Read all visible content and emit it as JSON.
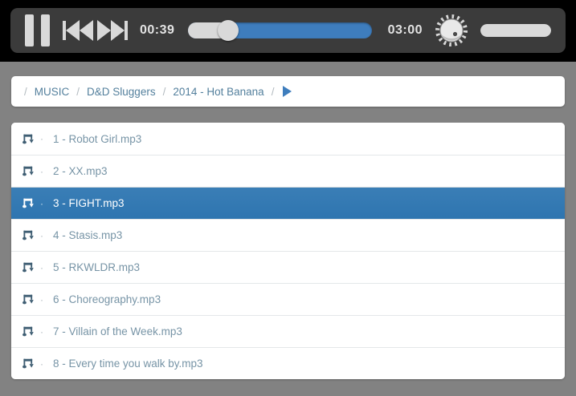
{
  "player": {
    "elapsed_time": "00:39",
    "total_time": "03:00",
    "progress_percent": 21.7,
    "volume_percent": 100
  },
  "breadcrumb": {
    "separator": "/",
    "items": [
      "MUSIC",
      "D&D Sluggers",
      "2014 - Hot Banana"
    ]
  },
  "playlist": {
    "bullet": "·",
    "selected_index": 2,
    "tracks": [
      "1 - Robot Girl.mp3",
      "2 - XX.mp3",
      "3 - FIGHT.mp3",
      "4 - Stasis.mp3",
      "5 - RKWLDR.mp3",
      "6 - Choreography.mp3",
      "7 - Villain of the Week.mp3",
      "8 - Every time you walk by.mp3"
    ]
  },
  "icons": {
    "pause": "two-vertical-bars",
    "previous": "bar-with-two-left-triangles",
    "next": "two-right-triangles-with-bar",
    "volume_knob": "rotary-knob-with-ticks",
    "music_file": "beamed-note-with-down-arrow",
    "play": "right-triangle"
  },
  "colors": {
    "background_gray": "#828282",
    "panel_dark": "#3b3b3b",
    "control_gray": "#d9d9d9",
    "accent_blue": "#3e7dbd",
    "selected_row": "#2e75b0",
    "selected_row_top": "#3a7eb6",
    "breadcrumb_link": "#54809d",
    "track_text": "#7794a6",
    "icon_slate": "#3f5e73"
  }
}
